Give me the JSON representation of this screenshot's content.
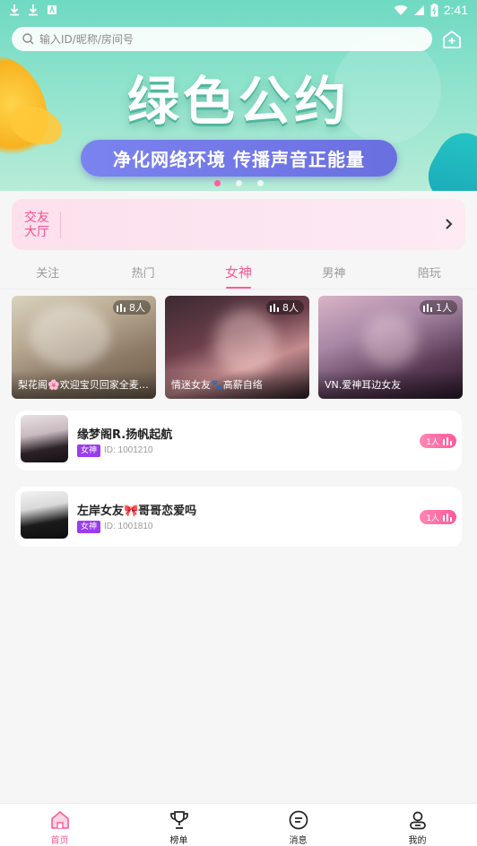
{
  "status_bar": {
    "time": "2:41"
  },
  "banner": {
    "slogan": "绿色公约",
    "subtitle": "净化网络环境  传播声音正能量",
    "dots": 3,
    "active_dot": 0
  },
  "search": {
    "placeholder": "输入ID/昵称/房间号"
  },
  "hall": {
    "label": "交友大厅"
  },
  "tabs": [
    {
      "label": "关注",
      "active": false
    },
    {
      "label": "热门",
      "active": false
    },
    {
      "label": "女神",
      "active": true
    },
    {
      "label": "男神",
      "active": false
    },
    {
      "label": "陪玩",
      "active": false
    }
  ],
  "featured": [
    {
      "title": "梨花阁🌸欢迎宝贝回家全麦…",
      "count": "8人"
    },
    {
      "title": "情迷女友🐾高薪自络",
      "count": "8人"
    },
    {
      "title": "VN.爱神耳边女友",
      "count": "1人"
    }
  ],
  "rooms": [
    {
      "name": "缘梦阁R.扬帆起航",
      "tag": "女神",
      "id": "ID: 1001210",
      "count": "1人"
    },
    {
      "name": "左岸女友🎀哥哥恋爱吗",
      "tag": "女神",
      "id": "ID: 1001810",
      "count": "1人"
    }
  ],
  "bottom_nav": [
    {
      "label": "首页",
      "icon": "home-icon",
      "active": true
    },
    {
      "label": "榜单",
      "icon": "trophy-icon",
      "active": false
    },
    {
      "label": "消息",
      "icon": "message-icon",
      "active": false
    },
    {
      "label": "我的",
      "icon": "profile-icon",
      "active": false
    }
  ],
  "colors": {
    "accent": "#ff5a96",
    "tag": "#9b3cf0",
    "banner": "#8fe3cc"
  }
}
